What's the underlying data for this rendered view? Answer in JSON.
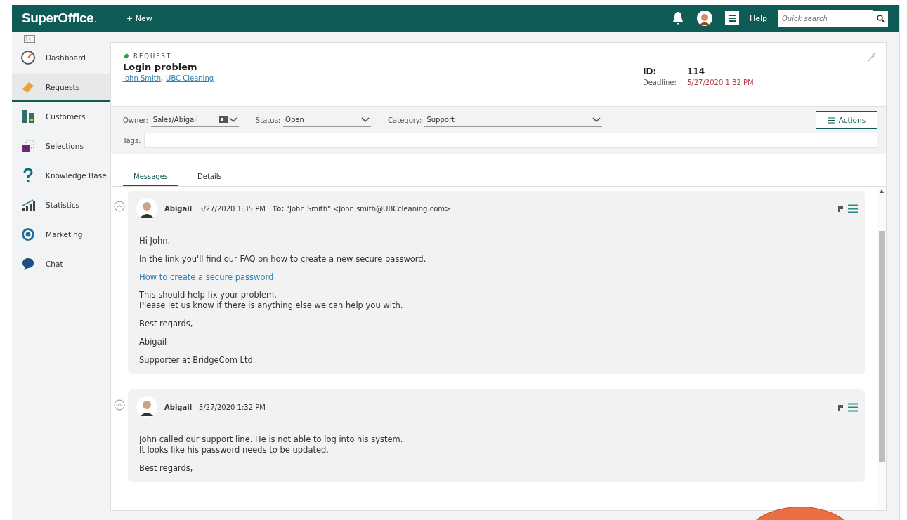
{
  "topbar": {
    "logo": "SuperOffice",
    "logo_dot": ".",
    "new_button": "+ New",
    "help": "Help",
    "search": {
      "placeholder": "Quick search"
    }
  },
  "sidebar": {
    "items": [
      {
        "label": "Dashboard",
        "selected": false
      },
      {
        "label": "Requests",
        "selected": true
      },
      {
        "label": "Customers",
        "selected": false
      },
      {
        "label": "Selections",
        "selected": false
      },
      {
        "label": "Knowledge Base",
        "selected": false
      },
      {
        "label": "Statistics",
        "selected": false
      },
      {
        "label": "Marketing",
        "selected": false
      },
      {
        "label": "Chat",
        "selected": false
      }
    ]
  },
  "request": {
    "type_label": "REQUEST",
    "title": "Login problem",
    "contact": "John Smith",
    "separator": ",",
    "company": "UBC Cleaning",
    "id_label": "ID:",
    "id": "114",
    "deadline_label": "Deadline:",
    "deadline": "5/27/2020 1:32 PM"
  },
  "fields": {
    "owner_label": "Owner:",
    "owner": "Sales/Abigail",
    "status_label": "Status:",
    "status": "Open",
    "category_label": "Category:",
    "category": "Support",
    "tags_label": "Tags:",
    "actions": "Actions"
  },
  "tabs": [
    {
      "label": "Messages",
      "selected": true
    },
    {
      "label": "Details",
      "selected": false
    }
  ],
  "messages": [
    {
      "author": "Abigail",
      "time": "5/27/2020 1:35 PM",
      "to_label": "To:",
      "to": "\"John Smith\" <John.smith@UBCcleaning.com>",
      "paragraphs": [
        {
          "kind": "text",
          "lines": [
            "Hi John,"
          ]
        },
        {
          "kind": "text",
          "lines": [
            "In the link you'll find our FAQ on how to create a new secure password."
          ]
        },
        {
          "kind": "link",
          "lines": [
            "How to create a secure password"
          ]
        },
        {
          "kind": "text",
          "lines": [
            "This should help fix your problem.",
            "Please let us know if there is anything else we can help you with."
          ]
        },
        {
          "kind": "text",
          "lines": [
            "Best regards,"
          ]
        },
        {
          "kind": "text",
          "lines": [
            "Abigail"
          ]
        },
        {
          "kind": "text",
          "lines": [
            "Supporter at BridgeCom Ltd."
          ]
        }
      ]
    },
    {
      "author": "Abigail",
      "time": "5/27/2020 1:32 PM",
      "paragraphs": [
        {
          "kind": "text",
          "lines": [
            "John called our support line. He is not able to log into his system.",
            "It looks like his password needs to be updated."
          ]
        },
        {
          "kind": "text",
          "lines": [
            "Best regards,"
          ]
        }
      ]
    }
  ]
}
